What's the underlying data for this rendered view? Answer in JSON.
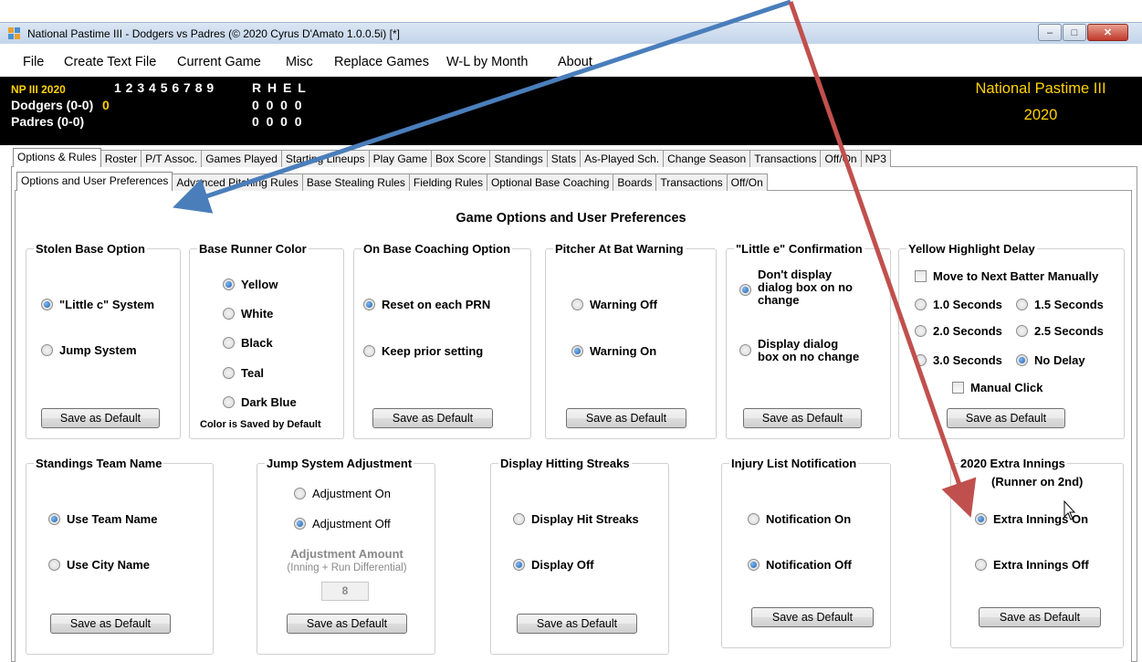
{
  "window": {
    "title": "National Pastime III - Dodgers vs Padres (© 2020 Cyrus D'Amato 1.0.0.5i) [*]"
  },
  "menu": [
    "File",
    "Create Text File",
    "Current Game",
    "Misc",
    "Replace Games",
    "W-L by Month",
    "About"
  ],
  "scoreboard": {
    "league": "NP III 2020",
    "innings": "1 2 3 4 5 6 7 8 9",
    "rhel": "R H E L",
    "teams": [
      {
        "name": "Dodgers (0-0)",
        "current": "0",
        "line": "0  0  0  0"
      },
      {
        "name": "Padres (0-0)",
        "current": "",
        "line": "0  0  0  0"
      }
    ],
    "brand_line1": "National Pastime III",
    "brand_line2": "2020"
  },
  "tabs_main": [
    "Options & Rules",
    "Roster",
    "P/T Assoc.",
    "Games Played",
    "Starting Lineups",
    "Play Game",
    "Box Score",
    "Standings",
    "Stats",
    "As-Played Sch.",
    "Change Season",
    "Transactions",
    "Off/On",
    "NP3"
  ],
  "tabs_sub": [
    "Options and User Preferences",
    "Advanced Pitching Rules",
    "Base Stealing Rules",
    "Fielding Rules",
    "Optional  Base Coaching",
    "Boards",
    "Transactions",
    "Off/On"
  ],
  "page_title": "Game Options and User Preferences",
  "save_label": "Save as Default",
  "groups": {
    "stolen_base": {
      "title": "Stolen Base Option",
      "options": [
        "\"Little c\" System",
        "Jump System"
      ]
    },
    "runner_color": {
      "title": "Base Runner Color",
      "options": [
        "Yellow",
        "White",
        "Black",
        "Teal",
        "Dark Blue"
      ],
      "note": "Color is Saved by Default"
    },
    "coaching": {
      "title": "On Base Coaching Option",
      "options": [
        "Reset on each PRN",
        "Keep prior setting"
      ]
    },
    "pitcher_warning": {
      "title": "Pitcher At Bat Warning",
      "options": [
        "Warning Off",
        "Warning On"
      ]
    },
    "little_e": {
      "title": "\"Little e\" Confirmation",
      "opt1": [
        "Don't display",
        "dialog box on no",
        "change"
      ],
      "opt2": [
        "Display dialog",
        "box on no change"
      ]
    },
    "highlight": {
      "title": "Yellow Highlight Delay",
      "manual_next": "Move to Next Batter Manually",
      "options": [
        "1.0 Seconds",
        "1.5 Seconds",
        "2.0 Seconds",
        "2.5 Seconds",
        "3.0 Seconds",
        "No Delay"
      ],
      "manual_click": "Manual Click"
    },
    "standings_name": {
      "title": "Standings Team Name",
      "options": [
        "Use Team Name",
        "Use City Name"
      ]
    },
    "jump_adj": {
      "title": "Jump System Adjustment",
      "options": [
        "Adjustment On",
        "Adjustment Off"
      ],
      "amount_label": "Adjustment Amount",
      "amount_hint": "(Inning + Run Differential)",
      "amount_value": "8"
    },
    "streaks": {
      "title": "Display Hitting Streaks",
      "options": [
        "Display Hit Streaks",
        "Display Off"
      ]
    },
    "injury": {
      "title": "Injury List Notification",
      "options": [
        "Notification On",
        "Notification Off"
      ]
    },
    "extra": {
      "title": "2020 Extra Innings",
      "subtitle": "(Runner on 2nd)",
      "options": [
        "Extra Innings On",
        "Extra Innings Off"
      ]
    }
  },
  "colors": {
    "accent_yellow": "#ffd200",
    "arrow_blue": "#4a7ebb",
    "arrow_red": "#c0504d",
    "radio_fill": "#1c5fb0"
  }
}
